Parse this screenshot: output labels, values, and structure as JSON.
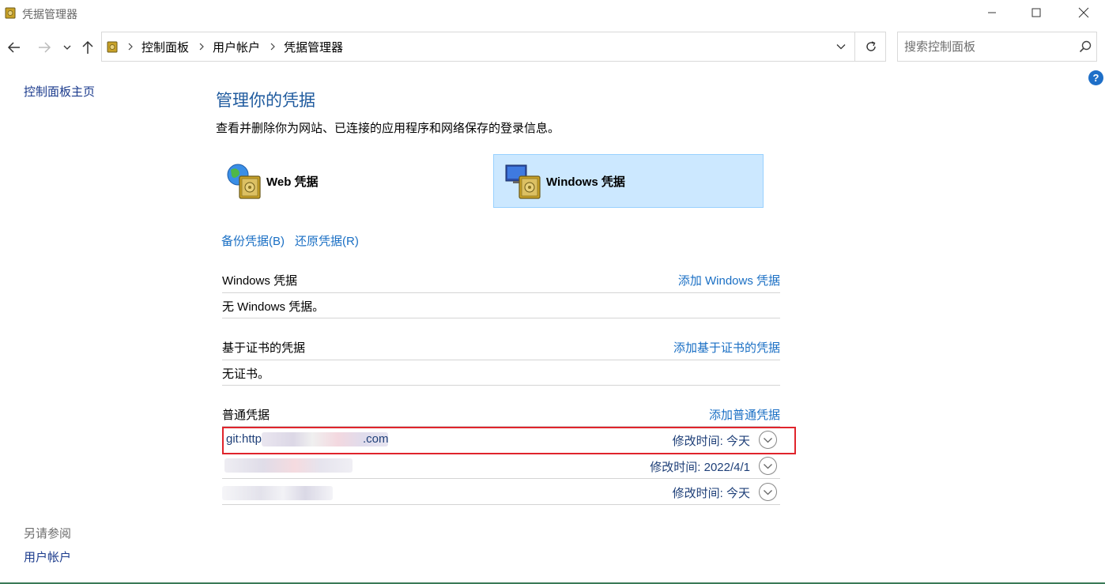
{
  "window": {
    "title": "凭据管理器"
  },
  "address": {
    "crumbs": [
      "控制面板",
      "用户帐户",
      "凭据管理器"
    ]
  },
  "search": {
    "placeholder": "搜索控制面板"
  },
  "help": {
    "label": "?"
  },
  "left_pane": {
    "home_link": "控制面板主页",
    "see_also_label": "另请参阅",
    "user_accounts_link": "用户帐户"
  },
  "main": {
    "title": "管理你的凭据",
    "description": "查看并删除你为网站、已连接的应用程序和网络保存的登录信息。",
    "credential_types": [
      {
        "label": "Web 凭据",
        "selected": false
      },
      {
        "label": "Windows 凭据",
        "selected": true
      }
    ],
    "backup_link": "备份凭据(B)",
    "restore_link": "还原凭据(R)",
    "sections": {
      "windows": {
        "name": "Windows 凭据",
        "add_link": "添加 Windows 凭据",
        "empty_text": "无 Windows 凭据。"
      },
      "certificate": {
        "name": "基于证书的凭据",
        "add_link": "添加基于证书的凭据",
        "empty_text": "无证书。"
      },
      "generic": {
        "name": "普通凭据",
        "add_link": "添加普通凭据",
        "entries": [
          {
            "address": "git:http",
            "address_suffix": ".com",
            "modified": "修改时间:  今天"
          },
          {
            "address": "",
            "address_suffix": "",
            "modified": "修改时间:  2022/4/1"
          },
          {
            "address": "",
            "address_suffix": "",
            "modified": "修改时间:  今天"
          }
        ]
      }
    }
  },
  "colors": {
    "link": "#1a6fc4",
    "title": "#1e5a9e",
    "selected_bg": "#cce8ff",
    "highlight_box": "#e0242c"
  },
  "icons": {
    "app": "vault-icon",
    "back": "arrow-left-icon",
    "forward": "arrow-right-icon",
    "recent": "chevron-down-icon",
    "up": "arrow-up-icon",
    "refresh": "refresh-icon",
    "search": "search-icon",
    "expand": "expand-circle-icon"
  }
}
